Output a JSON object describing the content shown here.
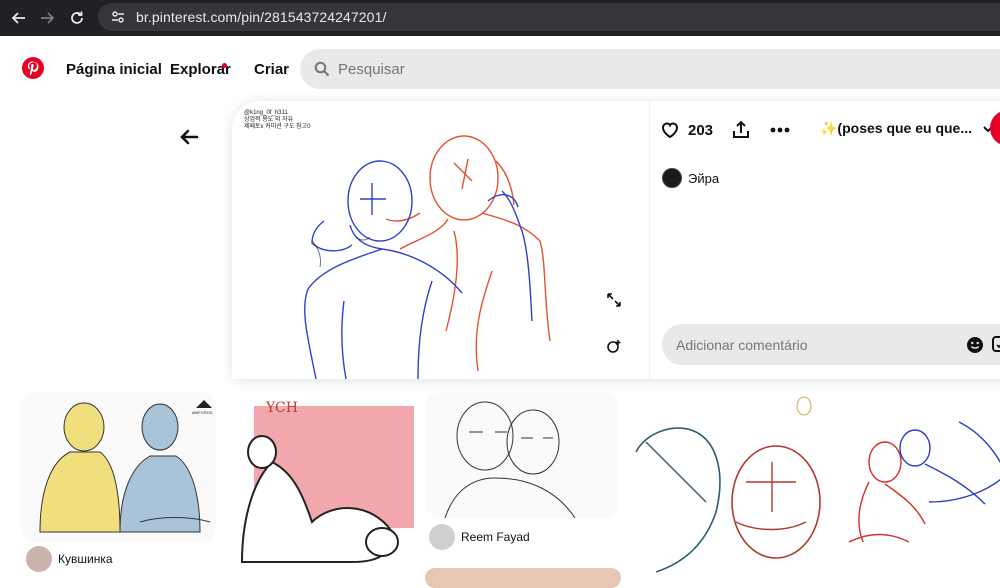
{
  "browser": {
    "url": "br.pinterest.com/pin/281543724247201/"
  },
  "header": {
    "home_label": "Página inicial",
    "explore_label": "Explorar",
    "create_label": "Criar",
    "search_placeholder": "Pesquisar"
  },
  "pin": {
    "caption_lines": [
      "@k1ng_0f_h311",
      "상업적 용도 외 자유",
      "제페토x 커미션 구도 참고0"
    ],
    "like_count": "203",
    "board_name": "✨(poses que eu que...",
    "author_name": "Эйра",
    "comment_placeholder": "Adicionar comentário"
  },
  "related": [
    {
      "user": "Кувшинка",
      "badge": "AWFORGS"
    },
    {
      "user": "",
      "handwritten": "YCH"
    },
    {
      "user": "Reem Fayad"
    },
    {
      "user": ""
    },
    {
      "user": ""
    }
  ],
  "colors": {
    "brand": "#e60023",
    "sketch_blue": "#2b44c9",
    "sketch_red": "#e0532e"
  }
}
